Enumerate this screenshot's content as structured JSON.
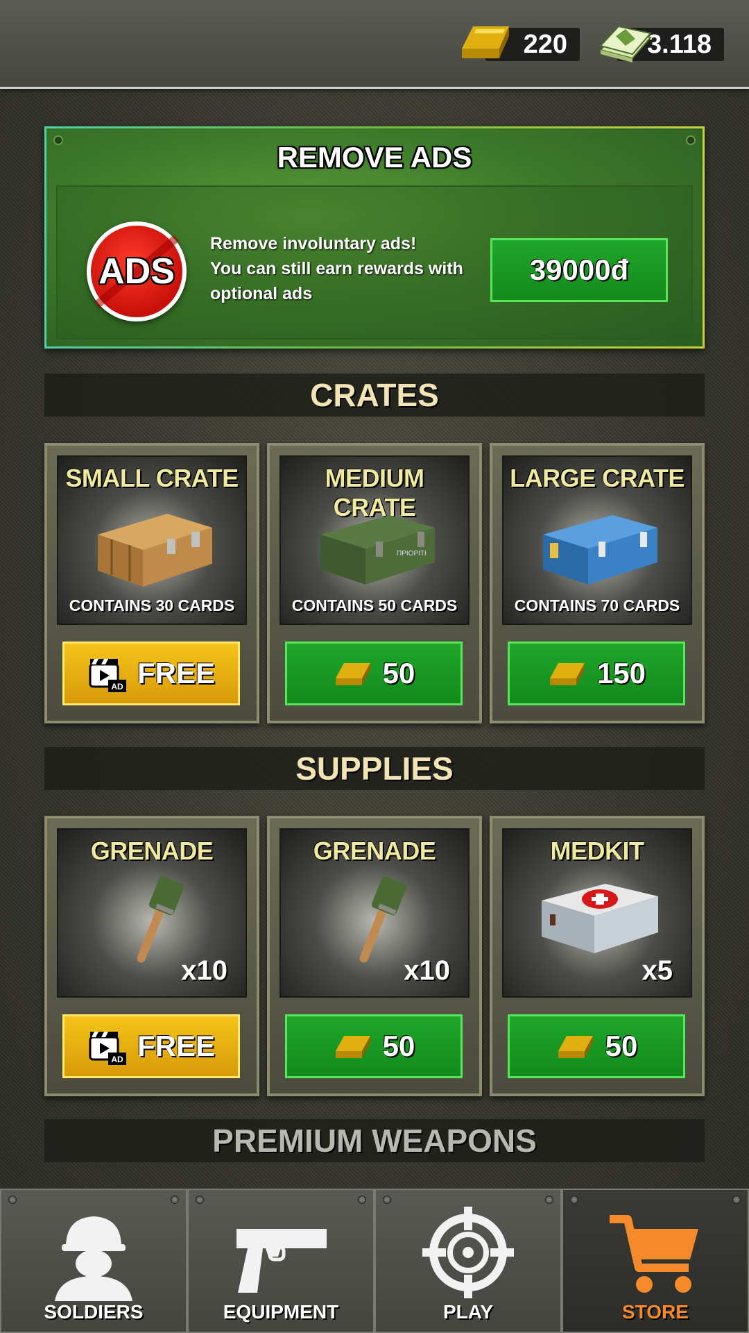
{
  "top_bar": {
    "gold_amount": "220",
    "cash_amount": "3.118",
    "gold_icon": "gold-bar-icon",
    "cash_icon": "cash-stack-icon"
  },
  "remove_ads": {
    "title": "REMOVE ADS",
    "badge_text": "ADS",
    "description_line1": "Remove involuntary ads!",
    "description_line2": "You can still earn rewards with",
    "description_line3": "optional ads",
    "price": "39000đ"
  },
  "crates": {
    "header": "CRATES",
    "items": [
      {
        "title": "SMALL CRATE",
        "subtitle": "CONTAINS 30 CARDS",
        "button": "FREE",
        "button_type": "ad",
        "icon": "wooden-crate-icon"
      },
      {
        "title": "MEDIUM CRATE",
        "subtitle": "CONTAINS 50 CARDS",
        "button": "50",
        "button_type": "gold",
        "icon": "military-crate-icon"
      },
      {
        "title": "LARGE CRATE",
        "subtitle": "CONTAINS 70 CARDS",
        "button": "150",
        "button_type": "gold",
        "icon": "blue-crate-icon"
      }
    ]
  },
  "supplies": {
    "header": "SUPPLIES",
    "items": [
      {
        "title": "GRENADE",
        "quantity": "x10",
        "button": "FREE",
        "button_type": "ad",
        "icon": "grenade-icon"
      },
      {
        "title": "GRENADE",
        "quantity": "x10",
        "button": "50",
        "button_type": "gold",
        "icon": "grenade-icon"
      },
      {
        "title": "MEDKIT",
        "quantity": "x5",
        "button": "50",
        "button_type": "gold",
        "icon": "medkit-icon"
      }
    ]
  },
  "premium_weapons": {
    "header": "PREMIUM WEAPONS"
  },
  "bottom_nav": {
    "tabs": [
      {
        "label": "SOLDIERS",
        "icon": "soldier-icon"
      },
      {
        "label": "EQUIPMENT",
        "icon": "pistol-icon"
      },
      {
        "label": "PLAY",
        "icon": "crosshair-icon"
      },
      {
        "label": "STORE",
        "icon": "shopping-cart-icon"
      }
    ],
    "active_tab": "STORE"
  },
  "colors": {
    "accent_green": "#1fa62a",
    "accent_gold": "#f5c41a",
    "active_tab": "#f58a2a",
    "title_cream": "#f0eaa0"
  }
}
